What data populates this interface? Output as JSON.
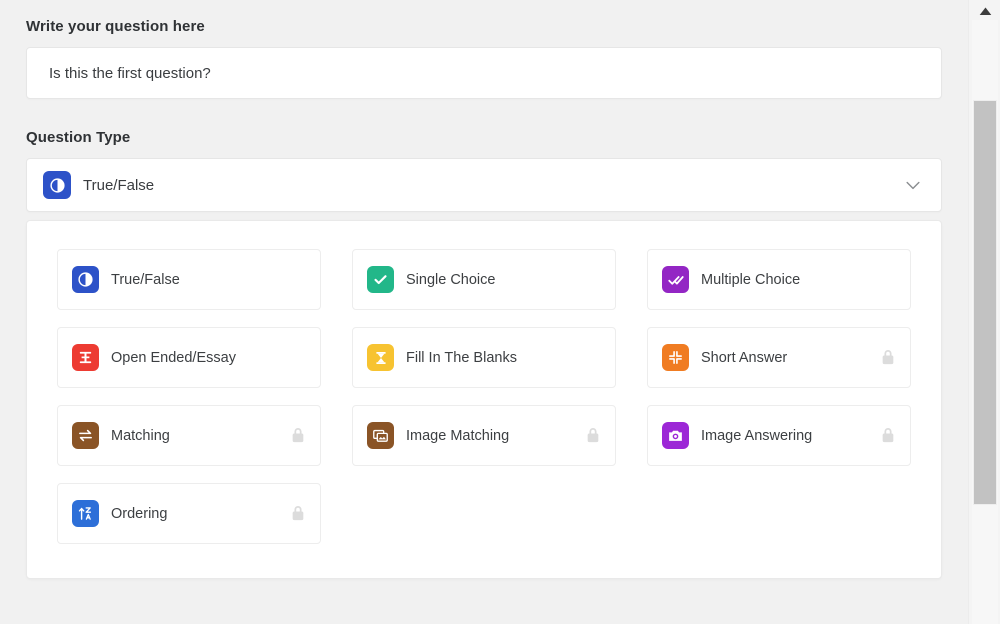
{
  "form": {
    "question_label": "Write your question here",
    "question_value": "Is this the first question?",
    "question_placeholder": "Write your question here",
    "type_label": "Question Type",
    "selected_type": "True/False",
    "selected_type_icon": "contrast-icon",
    "chevron_icon": "chevron-down-icon"
  },
  "question_types": [
    {
      "label": "True/False",
      "icon": "contrast-icon",
      "color": "#2d52c8",
      "locked": false
    },
    {
      "label": "Single Choice",
      "icon": "check-square-icon",
      "color": "#22b789",
      "locked": false
    },
    {
      "label": "Multiple Choice",
      "icon": "double-check-icon",
      "color": "#9326c4",
      "locked": false
    },
    {
      "label": "Open Ended/Essay",
      "icon": "essay-icon",
      "color": "#ed3b32",
      "locked": false
    },
    {
      "label": "Fill In The Blanks",
      "icon": "hourglass-icon",
      "color": "#f7c331",
      "locked": false
    },
    {
      "label": "Short Answer",
      "icon": "compress-icon",
      "color": "#f07c22",
      "locked": true
    },
    {
      "label": "Matching",
      "icon": "exchange-icon",
      "color": "#8a5426",
      "locked": true
    },
    {
      "label": "Image Matching",
      "icon": "image-icon",
      "color": "#8a5426",
      "locked": true
    },
    {
      "label": "Image Answering",
      "icon": "camera-icon",
      "color": "#9c27d6",
      "locked": true
    },
    {
      "label": "Ordering",
      "icon": "sort-az-icon",
      "color": "#2d6fd8",
      "locked": false
    }
  ],
  "scrollbar": {
    "up_arrow_icon": "triangle-up-icon",
    "thumb_name": "scrollbar-thumb"
  },
  "colors": {
    "page_background": "#f1f1f1",
    "panel_background": "#ffffff",
    "border": "#e6e6e6",
    "text": "#3a3d40",
    "lock": "#dcdcdc"
  }
}
